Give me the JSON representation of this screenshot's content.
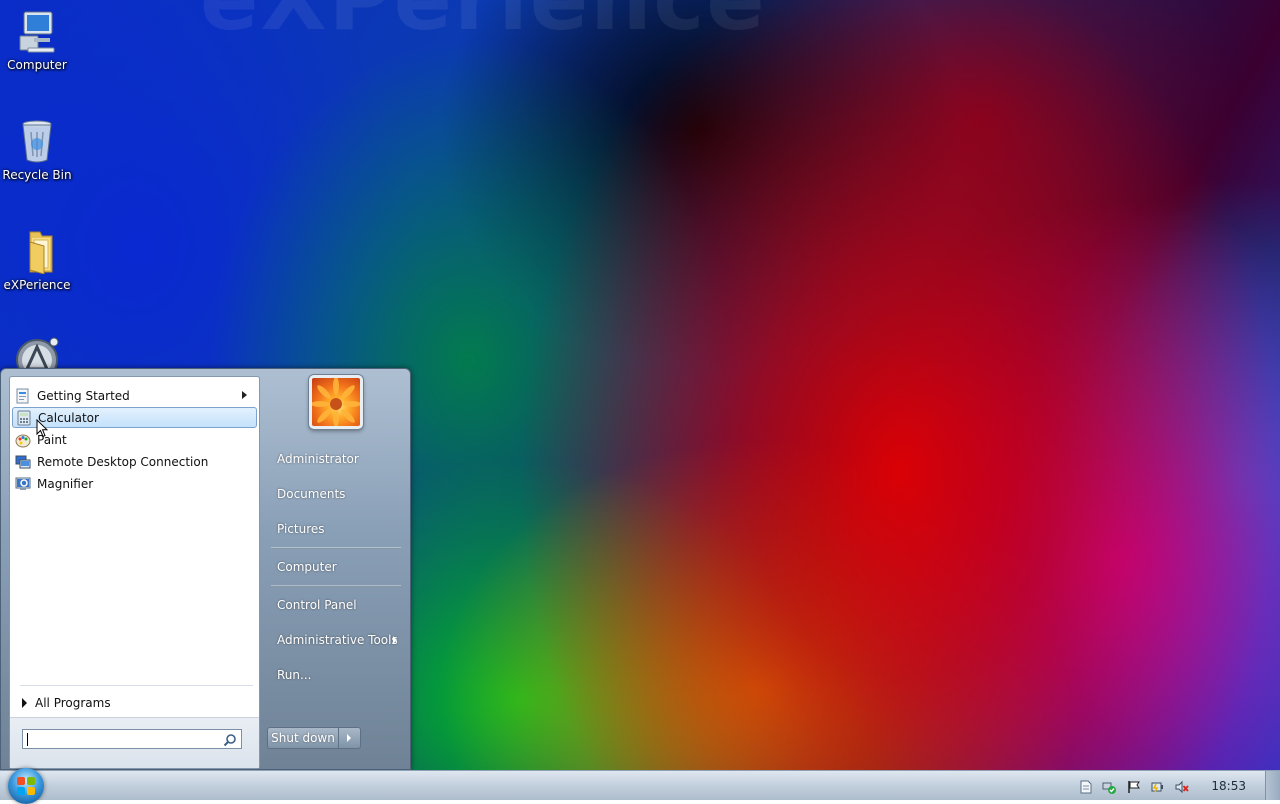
{
  "desktop": {
    "watermark": "eXPerience",
    "icons": [
      {
        "label": "Computer",
        "icon": "computer-icon"
      },
      {
        "label": "Recycle Bin",
        "icon": "recycle-bin-icon"
      },
      {
        "label": "eXPerience",
        "icon": "folder-icon"
      },
      {
        "label": "",
        "icon": "app-icon"
      }
    ]
  },
  "start_menu": {
    "programs": [
      {
        "label": "Getting Started",
        "icon": "getting-started-icon",
        "has_submenu": true
      },
      {
        "label": "Calculator",
        "icon": "calculator-icon",
        "highlighted": true
      },
      {
        "label": "Paint",
        "icon": "paint-icon"
      },
      {
        "label": "Remote Desktop Connection",
        "icon": "remote-desktop-icon"
      },
      {
        "label": "Magnifier",
        "icon": "magnifier-icon"
      }
    ],
    "all_programs": "All Programs",
    "search": {
      "value": "",
      "placeholder": ""
    },
    "right_links": [
      {
        "label": "Administrator"
      },
      {
        "label": "Documents"
      },
      {
        "label": "Pictures"
      },
      {
        "label": "Computer"
      },
      {
        "label": "Control Panel"
      },
      {
        "label": "Administrative Tools",
        "has_submenu": true
      },
      {
        "label": "Run..."
      }
    ],
    "shutdown_label": "Shut down"
  },
  "taskbar": {
    "clock": "18:53",
    "tray_icons": [
      "document-icon",
      "network-icon",
      "flag-icon",
      "power-icon",
      "volume-muted-icon"
    ]
  },
  "colors": {
    "accent": "#3c9be0",
    "highlight_border": "#7da2ce"
  }
}
